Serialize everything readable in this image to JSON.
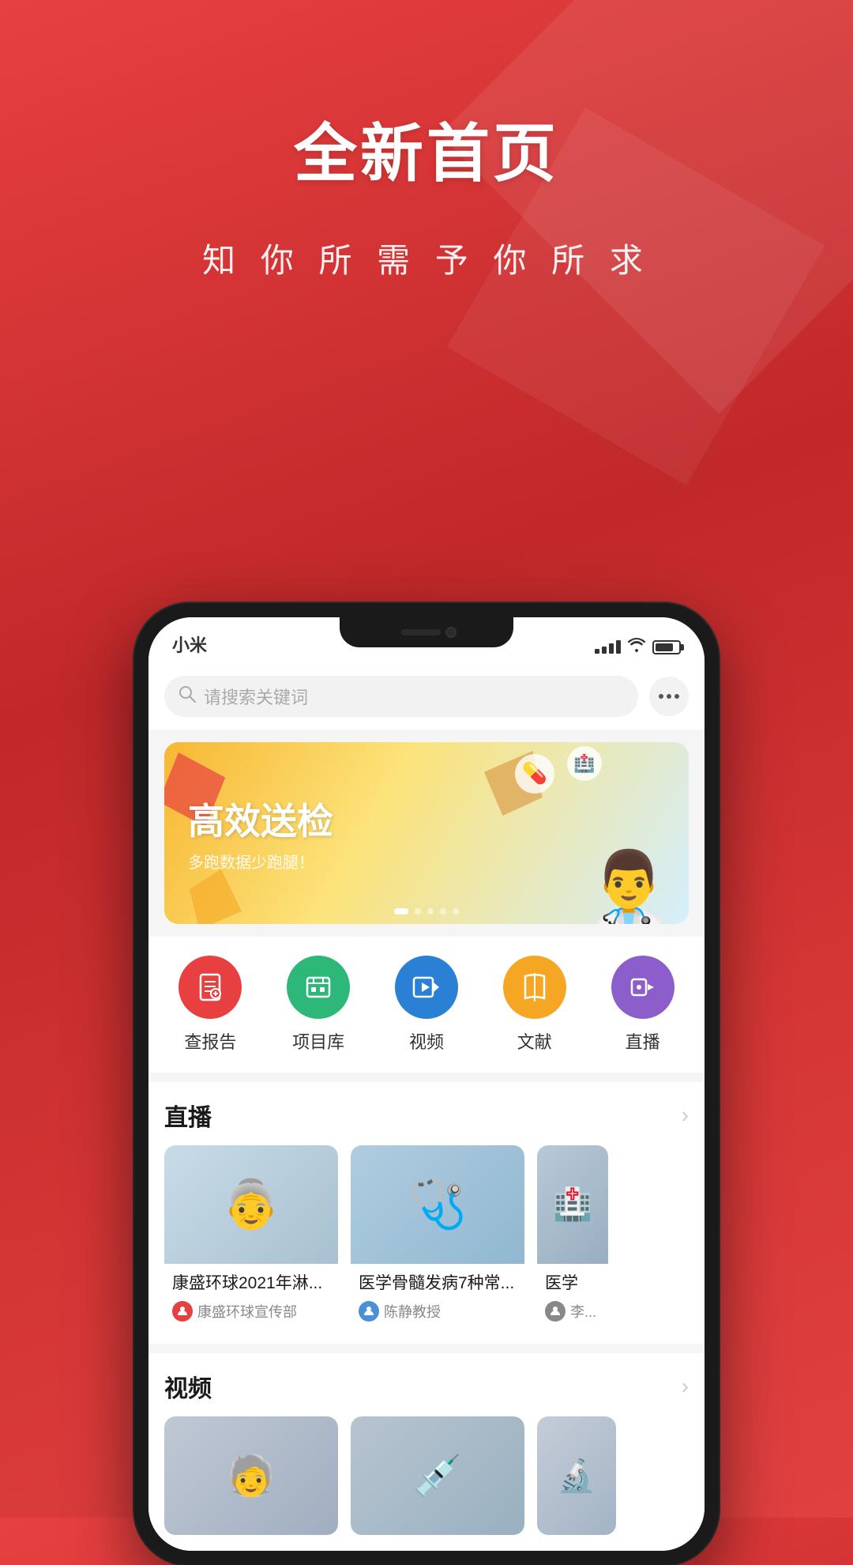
{
  "header": {
    "title": "全新首页",
    "subtitle": "知 你 所 需   予 你 所 求"
  },
  "phone": {
    "carrier": "小米",
    "signal_bars": [
      3,
      5,
      7,
      10,
      12
    ],
    "battery_pct": 80
  },
  "app": {
    "search": {
      "placeholder": "请搜索关键词"
    },
    "banner": {
      "title": "高效送检",
      "subtitle": "多跑数据少跑腿！",
      "dots": [
        true,
        false,
        false,
        false,
        false
      ]
    },
    "quick_actions": [
      {
        "id": "report",
        "label": "查报告",
        "color": "#e84040"
      },
      {
        "id": "project",
        "label": "项目库",
        "color": "#2db87a"
      },
      {
        "id": "video",
        "label": "视频",
        "color": "#2a80d4"
      },
      {
        "id": "literature",
        "label": "文献",
        "color": "#f5a623"
      },
      {
        "id": "live",
        "label": "直播",
        "color": "#8c5ecb"
      }
    ],
    "live_section": {
      "title": "直播",
      "more_label": "",
      "cards": [
        {
          "title": "康盛环球2021年淋...",
          "author": "康盛环球宣传部",
          "thumb_color": "#b8cce4",
          "thumb_emoji": "👴"
        },
        {
          "title": "医学骨髓发病7种常...",
          "author": "陈静教授",
          "thumb_color": "#d0e8f0",
          "thumb_emoji": "🩺"
        },
        {
          "title": "医学",
          "author": "李...",
          "thumb_color": "#c8d8e8",
          "thumb_emoji": "🏥"
        }
      ]
    },
    "video_section": {
      "title": "视频",
      "more_label": ""
    }
  }
}
